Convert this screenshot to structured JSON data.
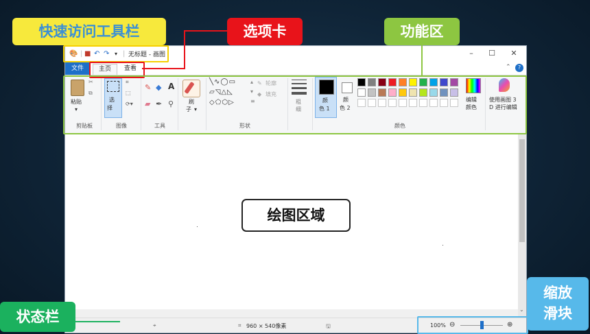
{
  "annotations": {
    "quick_access": "快速访问工具栏",
    "tabs": "选项卡",
    "ribbon": "功能区",
    "drawing_area": "绘图区域",
    "status_bar": "状态栏",
    "zoom_slider": "缩放\n滑块"
  },
  "colors": {
    "quick_access": "#f7e93c",
    "tabs": "#e8131a",
    "ribbon": "#8dc641",
    "status_bar": "#1bb15e",
    "zoom_slider": "#57b9ea",
    "selected_tab": "#1e6fc8"
  },
  "window": {
    "title": "无标题 - 画图",
    "minimize": "–",
    "maximize": "☐",
    "close": "✕"
  },
  "tabs": {
    "file": "文件",
    "home": "主页",
    "view": "查看"
  },
  "ribbon": {
    "clipboard": {
      "paste": "粘贴",
      "label": "剪贴板"
    },
    "image": {
      "select_1": "选",
      "select_2": "择",
      "label": "图像"
    },
    "tools": {
      "label": "工具"
    },
    "brushes": {
      "label_1": "刷",
      "label_2": "子"
    },
    "shapes": {
      "outline": "轮廓",
      "fill": "填充",
      "label": "形状"
    },
    "size": {
      "label_1": "粗",
      "label_2": "细"
    },
    "color1": {
      "label_1": "颜",
      "label_2": "色 1"
    },
    "color2": {
      "label_1": "颜",
      "label_2": "色 2"
    },
    "edit_colors": {
      "label_1": "编辑",
      "label_2": "颜色"
    },
    "paint3d": {
      "label_1": "使用画图 3",
      "label_2": "D 进行编辑"
    },
    "colors_label": "颜色",
    "palette_row1": [
      "#000000",
      "#7f7f7f",
      "#880015",
      "#ed1c24",
      "#ff7f27",
      "#fff200",
      "#22b14c",
      "#00a2e8",
      "#3f48cc",
      "#a349a4"
    ],
    "palette_row2": [
      "#ffffff",
      "#c3c3c3",
      "#b97a57",
      "#ffaec9",
      "#ffc90e",
      "#efe4b0",
      "#b5e61d",
      "#99d9ea",
      "#7092be",
      "#c8bfe7"
    ]
  },
  "status": {
    "canvas_size": "960 × 540像素",
    "zoom": "100%",
    "zoom_level": 0.5
  }
}
